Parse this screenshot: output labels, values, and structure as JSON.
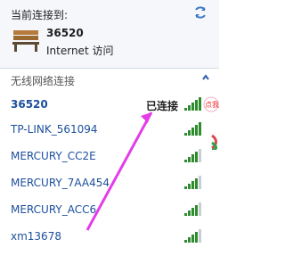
{
  "top": {
    "title": "当前连接到:",
    "network_name": "36520",
    "access": "Internet 访问"
  },
  "wireless": {
    "header": "无线网络连接",
    "networks": [
      {
        "name": "36520",
        "status": "已连接",
        "bars": 5
      },
      {
        "name": "TP-LINK_561094",
        "bars": 5
      },
      {
        "name": "MERCURY_CC2E",
        "bars": 4
      },
      {
        "name": "MERCURY_7AA454",
        "bars": 4
      },
      {
        "name": "MERCURY_ACC6",
        "bars": 4
      },
      {
        "name": "xm13678",
        "bars": 4
      }
    ]
  },
  "badge": {
    "text": "点我"
  },
  "colors": {
    "link": "#1c4f9c",
    "signal_on": "#2e8b2e",
    "signal_off": "#c8cdd3",
    "arrow": "#e33de8"
  },
  "icons": [
    "refresh-icon",
    "bench-icon",
    "collapse-icon",
    "signal-icon",
    "arrow-annotation"
  ]
}
